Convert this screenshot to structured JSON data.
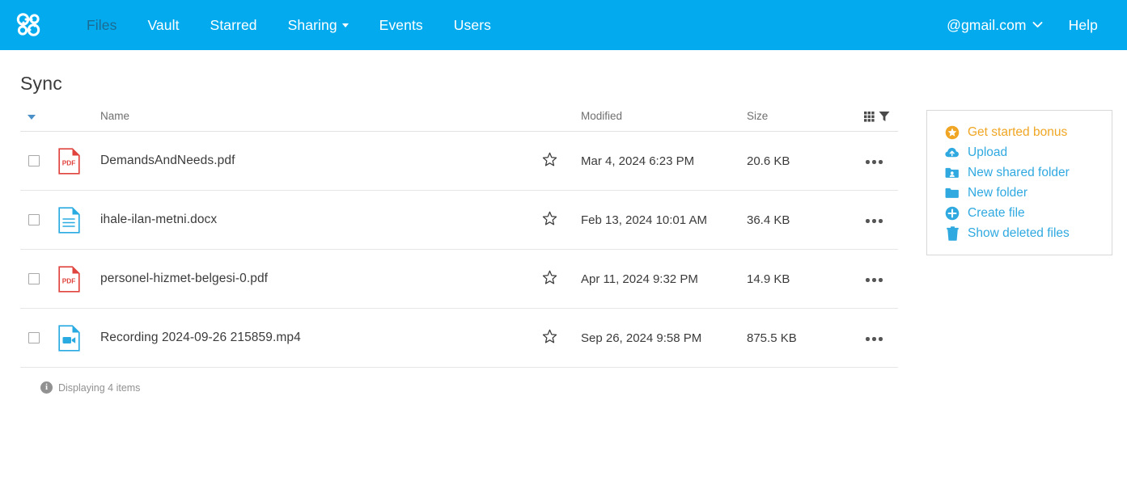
{
  "header": {
    "logo_icon": "cloud-molecule-logo",
    "nav": [
      {
        "label": "Files",
        "active": true,
        "caret": false
      },
      {
        "label": "Vault",
        "active": false,
        "caret": false
      },
      {
        "label": "Starred",
        "active": false,
        "caret": false
      },
      {
        "label": "Sharing",
        "active": false,
        "caret": true
      },
      {
        "label": "Events",
        "active": false,
        "caret": false
      },
      {
        "label": "Users",
        "active": false,
        "caret": false
      }
    ],
    "account_label": "@gmail.com",
    "help_label": "Help",
    "bg_color": "#03ABEE",
    "active_color": "#1c6b93"
  },
  "page": {
    "title": "Sync"
  },
  "table": {
    "columns": {
      "name": "Name",
      "modified": "Modified",
      "size": "Size"
    },
    "sort_icon": "sort-descending-caret-icon",
    "tools": {
      "columns_icon": "grid-columns-icon",
      "filter_icon": "filter-funnel-icon"
    },
    "rows": [
      {
        "name": "DemandsAndNeeds.pdf",
        "type": "pdf",
        "icon": "pdf-file-icon",
        "modified": "Mar 4, 2024 6:23 PM",
        "size": "20.6 KB",
        "starred": false
      },
      {
        "name": "ihale-ilan-metni.docx",
        "type": "docx",
        "icon": "document-file-icon",
        "modified": "Feb 13, 2024 10:01 AM",
        "size": "36.4 KB",
        "starred": false
      },
      {
        "name": "personel-hizmet-belgesi-0.pdf",
        "type": "pdf",
        "icon": "pdf-file-icon",
        "modified": "Apr 11, 2024 9:32 PM",
        "size": "14.9 KB",
        "starred": false
      },
      {
        "name": "Recording 2024-09-26 215859.mp4",
        "type": "mp4",
        "icon": "video-file-icon",
        "modified": "Sep 26, 2024 9:58 PM",
        "size": "875.5 KB",
        "starred": false
      }
    ]
  },
  "footer": {
    "info_icon": "info-icon",
    "status": "Displaying 4 items"
  },
  "actions": {
    "items": [
      {
        "label": "Get started bonus",
        "icon": "star-badge-icon",
        "color": "#F0A624"
      },
      {
        "label": "Upload",
        "icon": "cloud-upload-icon",
        "color": "#2fa9e0"
      },
      {
        "label": "New shared folder",
        "icon": "shared-folder-icon",
        "color": "#2fa9e0"
      },
      {
        "label": "New folder",
        "icon": "folder-icon",
        "color": "#2fa9e0"
      },
      {
        "label": "Create file",
        "icon": "plus-circle-icon",
        "color": "#2fa9e0"
      },
      {
        "label": "Show deleted files",
        "icon": "trash-icon",
        "color": "#2fa9e0"
      }
    ]
  }
}
